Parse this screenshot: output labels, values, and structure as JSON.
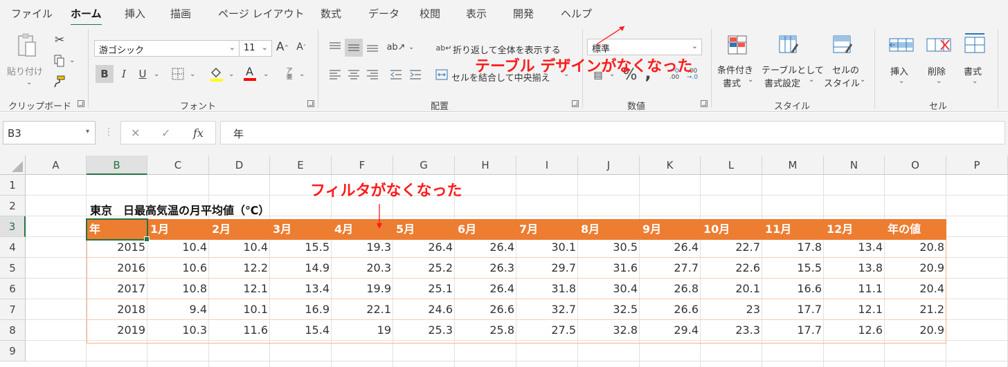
{
  "menu": {
    "tabs": [
      "ファイル",
      "ホーム",
      "挿入",
      "描画",
      "ページ レイアウト",
      "数式",
      "データ",
      "校閲",
      "表示",
      "開発",
      "ヘルプ"
    ]
  },
  "ribbon": {
    "clipboard": {
      "paste": "貼り付け",
      "label": "クリップボード"
    },
    "font": {
      "name": "游ゴシック",
      "size": "11",
      "label": "フォント",
      "bold": "B",
      "italic": "I",
      "underline": "U"
    },
    "alignment": {
      "wrap": "折り返して全体を表示する",
      "merge": "セルを結合して中央揃え",
      "label": "配置"
    },
    "number": {
      "format": "標準",
      "label": "数値"
    },
    "styles": {
      "conditional_1": "条件付き",
      "conditional_2": "書式",
      "table_1": "テーブルとして",
      "table_2": "書式設定",
      "cell_1": "セルの",
      "cell_2": "スタイル",
      "label": "スタイル"
    },
    "cells": {
      "insert": "挿入",
      "delete": "削除",
      "format": "書式",
      "label": "セル"
    }
  },
  "annotations": {
    "table_design_gone": "テーブル デザインがなくなった",
    "filter_gone": "フィルタがなくなった"
  },
  "formula_bar": {
    "name_box": "B3",
    "formula": "年"
  },
  "grid": {
    "columns": [
      "A",
      "B",
      "C",
      "D",
      "E",
      "F",
      "G",
      "H",
      "I",
      "J",
      "K",
      "L",
      "M",
      "N",
      "O",
      "P"
    ],
    "rows": [
      "1",
      "2",
      "3",
      "4",
      "5",
      "6",
      "7",
      "8",
      "9"
    ],
    "selected_column": "B",
    "selected_row": "3"
  },
  "sheet": {
    "title": "東京　日最高気温の月平均値（℃）",
    "table_color": "#ed7d31",
    "headers": [
      "年",
      "1月",
      "2月",
      "3月",
      "4月",
      "5月",
      "6月",
      "7月",
      "8月",
      "9月",
      "10月",
      "11月",
      "12月",
      "年の値"
    ],
    "rows": [
      [
        "2015",
        "10.4",
        "10.4",
        "15.5",
        "19.3",
        "26.4",
        "26.4",
        "30.1",
        "30.5",
        "26.4",
        "22.7",
        "17.8",
        "13.4",
        "20.8"
      ],
      [
        "2016",
        "10.6",
        "12.2",
        "14.9",
        "20.3",
        "25.2",
        "26.3",
        "29.7",
        "31.6",
        "27.7",
        "22.6",
        "15.5",
        "13.8",
        "20.9"
      ],
      [
        "2017",
        "10.8",
        "12.1",
        "13.4",
        "19.9",
        "25.1",
        "26.4",
        "31.8",
        "30.4",
        "26.8",
        "20.1",
        "16.6",
        "11.1",
        "20.4"
      ],
      [
        "2018",
        "9.4",
        "10.1",
        "16.9",
        "22.1",
        "24.6",
        "26.6",
        "32.7",
        "32.5",
        "26.6",
        "23",
        "17.7",
        "12.1",
        "21.2"
      ],
      [
        "2019",
        "10.3",
        "11.6",
        "15.4",
        "19",
        "25.3",
        "25.8",
        "27.5",
        "32.8",
        "29.4",
        "23.3",
        "17.7",
        "12.6",
        "20.9"
      ]
    ]
  }
}
